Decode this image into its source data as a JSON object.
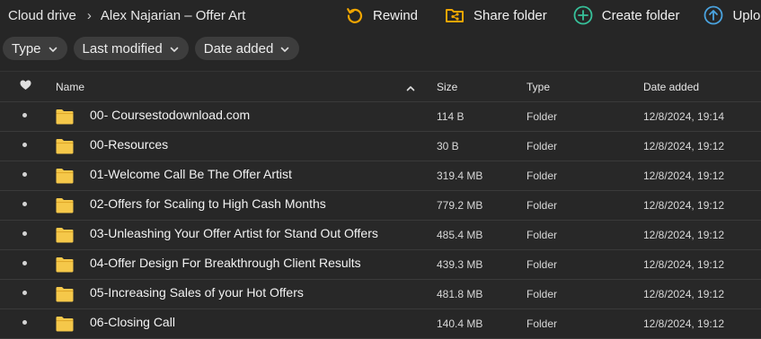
{
  "breadcrumb": {
    "root": "Cloud drive",
    "current": "Alex Najarian – Offer Art"
  },
  "toolbar": {
    "rewind": "Rewind",
    "share": "Share folder",
    "create": "Create folder",
    "upload": "Upload..."
  },
  "filters": [
    "Type",
    "Last modified",
    "Date added"
  ],
  "table": {
    "headers": {
      "name": "Name",
      "size": "Size",
      "type": "Type",
      "date": "Date added"
    },
    "rows": [
      {
        "name": "00- Coursestodownload.com",
        "size": "114 B",
        "type": "Folder",
        "date": "12/8/2024, 19:14"
      },
      {
        "name": "00-Resources",
        "size": "30 B",
        "type": "Folder",
        "date": "12/8/2024, 19:12"
      },
      {
        "name": "01-Welcome Call Be The Offer Artist",
        "size": "319.4 MB",
        "type": "Folder",
        "date": "12/8/2024, 19:12"
      },
      {
        "name": "02-Offers for Scaling to High Cash Months",
        "size": "779.2 MB",
        "type": "Folder",
        "date": "12/8/2024, 19:12"
      },
      {
        "name": "03-Unleashing Your Offer Artist for Stand Out Offers",
        "size": "485.4 MB",
        "type": "Folder",
        "date": "12/8/2024, 19:12"
      },
      {
        "name": "04-Offer Design For Breakthrough Client Results",
        "size": "439.3 MB",
        "type": "Folder",
        "date": "12/8/2024, 19:12"
      },
      {
        "name": "05-Increasing Sales of your Hot Offers",
        "size": "481.8 MB",
        "type": "Folder",
        "date": "12/8/2024, 19:12"
      },
      {
        "name": "06-Closing Call",
        "size": "140.4 MB",
        "type": "Folder",
        "date": "12/8/2024, 19:12"
      }
    ]
  },
  "colors": {
    "background": "#262626",
    "rewind_icon": "#f0a500",
    "share_icon": "#f0a500",
    "create_icon": "#37c19a",
    "upload_icon": "#4aa3df",
    "folder": "#f5c84a"
  }
}
